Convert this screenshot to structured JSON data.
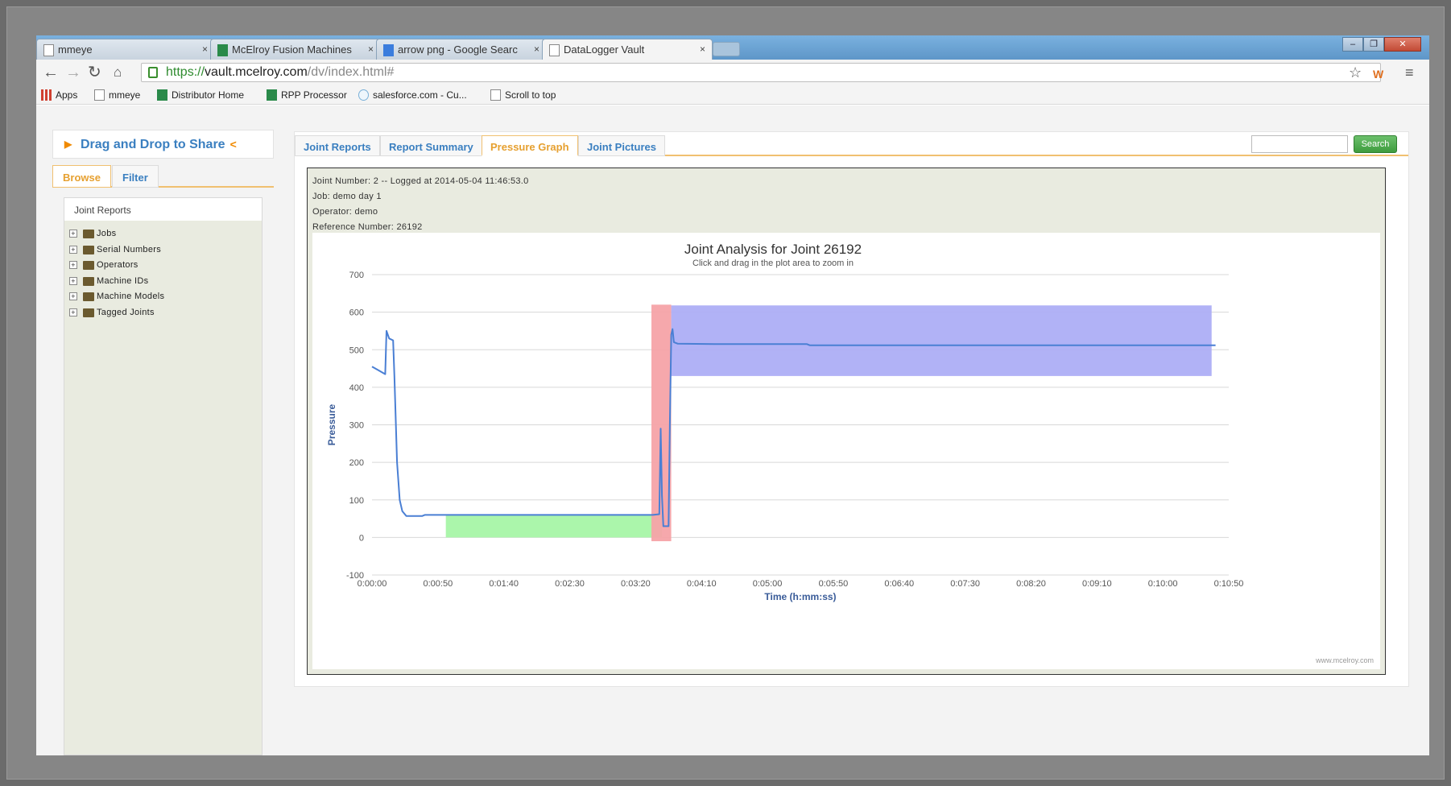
{
  "browser": {
    "tabs": [
      {
        "label": "mmeye",
        "close": "×"
      },
      {
        "label": "McElroy Fusion Machines",
        "close": "×"
      },
      {
        "label": "arrow png - Google Searc",
        "close": "×"
      },
      {
        "label": "DataLogger Vault",
        "close": "×"
      }
    ],
    "url_scheme": "https://",
    "url_host": "vault.mcelroy.com",
    "url_path": "/dv/index.html#",
    "bookmarks": [
      "Apps",
      "mmeye",
      "Distributor Home",
      "RPP Processor",
      "salesforce.com - Cu...",
      "Scroll to top"
    ]
  },
  "sidebar": {
    "share_title": "Drag and Drop to Share",
    "tabs": [
      "Browse",
      "Filter"
    ],
    "tree_title": "Joint Reports",
    "tree_items": [
      "Jobs",
      "Serial Numbers",
      "Operators",
      "Machine IDs",
      "Machine Models",
      "Tagged Joints"
    ]
  },
  "main": {
    "tabs": [
      "Joint Reports",
      "Report Summary",
      "Pressure Graph",
      "Joint Pictures"
    ],
    "search_button": "Search",
    "meta": {
      "joint_line": "Joint Number: 2 -- Logged at 2014-05-04 11:46:53.0",
      "job_line": "Job: demo day 1",
      "operator_line": "Operator: demo",
      "reference_line": "Reference Number: 26192"
    }
  },
  "chart_data": {
    "type": "line",
    "title": "Joint Analysis for Joint 26192",
    "subtitle": "Click and drag in the plot area to zoom in",
    "xlabel": "Time (h:mm:ss)",
    "ylabel": "Pressure",
    "credit": "www.mcelroy.com",
    "x_unit": "seconds",
    "xlim": [
      0,
      650
    ],
    "ylim": [
      -100,
      700
    ],
    "yticks": [
      -100,
      0,
      100,
      200,
      300,
      400,
      500,
      600,
      700
    ],
    "xticks": [
      0,
      50,
      100,
      150,
      200,
      250,
      300,
      350,
      400,
      450,
      500,
      550,
      600,
      650
    ],
    "xtick_labels": [
      "0:00:00",
      "0:00:50",
      "0:01:40",
      "0:02:30",
      "0:03:20",
      "0:04:10",
      "0:05:00",
      "0:05:50",
      "0:06:40",
      "0:07:30",
      "0:08:20",
      "0:09:10",
      "0:10:00",
      "0:10:50"
    ],
    "grid": true,
    "bands": [
      {
        "x": [
          56,
          220
        ],
        "y": [
          0,
          60
        ],
        "color": "#a6f5a6"
      },
      {
        "x": [
          212,
          227
        ],
        "y": [
          -10,
          620
        ],
        "color": "#f5a3a8"
      },
      {
        "x": [
          227,
          637
        ],
        "y": [
          430,
          618
        ],
        "color": "#adaef5"
      }
    ],
    "series": [
      {
        "color": "#4a7fd4",
        "points": [
          [
            0,
            455
          ],
          [
            5,
            445
          ],
          [
            10,
            435
          ],
          [
            11,
            550
          ],
          [
            13,
            530
          ],
          [
            16,
            525
          ],
          [
            17,
            430
          ],
          [
            19,
            200
          ],
          [
            21,
            100
          ],
          [
            23,
            70
          ],
          [
            26,
            57
          ],
          [
            30,
            57
          ],
          [
            38,
            57
          ],
          [
            40,
            60
          ],
          [
            60,
            60
          ],
          [
            100,
            60
          ],
          [
            150,
            60
          ],
          [
            200,
            60
          ],
          [
            213,
            60
          ],
          [
            218,
            62
          ],
          [
            219,
            290
          ],
          [
            220,
            110
          ],
          [
            221,
            30
          ],
          [
            225,
            30
          ],
          [
            226,
            300
          ],
          [
            227,
            540
          ],
          [
            228,
            555
          ],
          [
            229,
            520
          ],
          [
            232,
            516
          ],
          [
            260,
            515
          ],
          [
            300,
            515
          ],
          [
            330,
            515
          ],
          [
            332,
            512
          ],
          [
            400,
            512
          ],
          [
            500,
            512
          ],
          [
            600,
            512
          ],
          [
            640,
            512
          ]
        ]
      }
    ]
  }
}
